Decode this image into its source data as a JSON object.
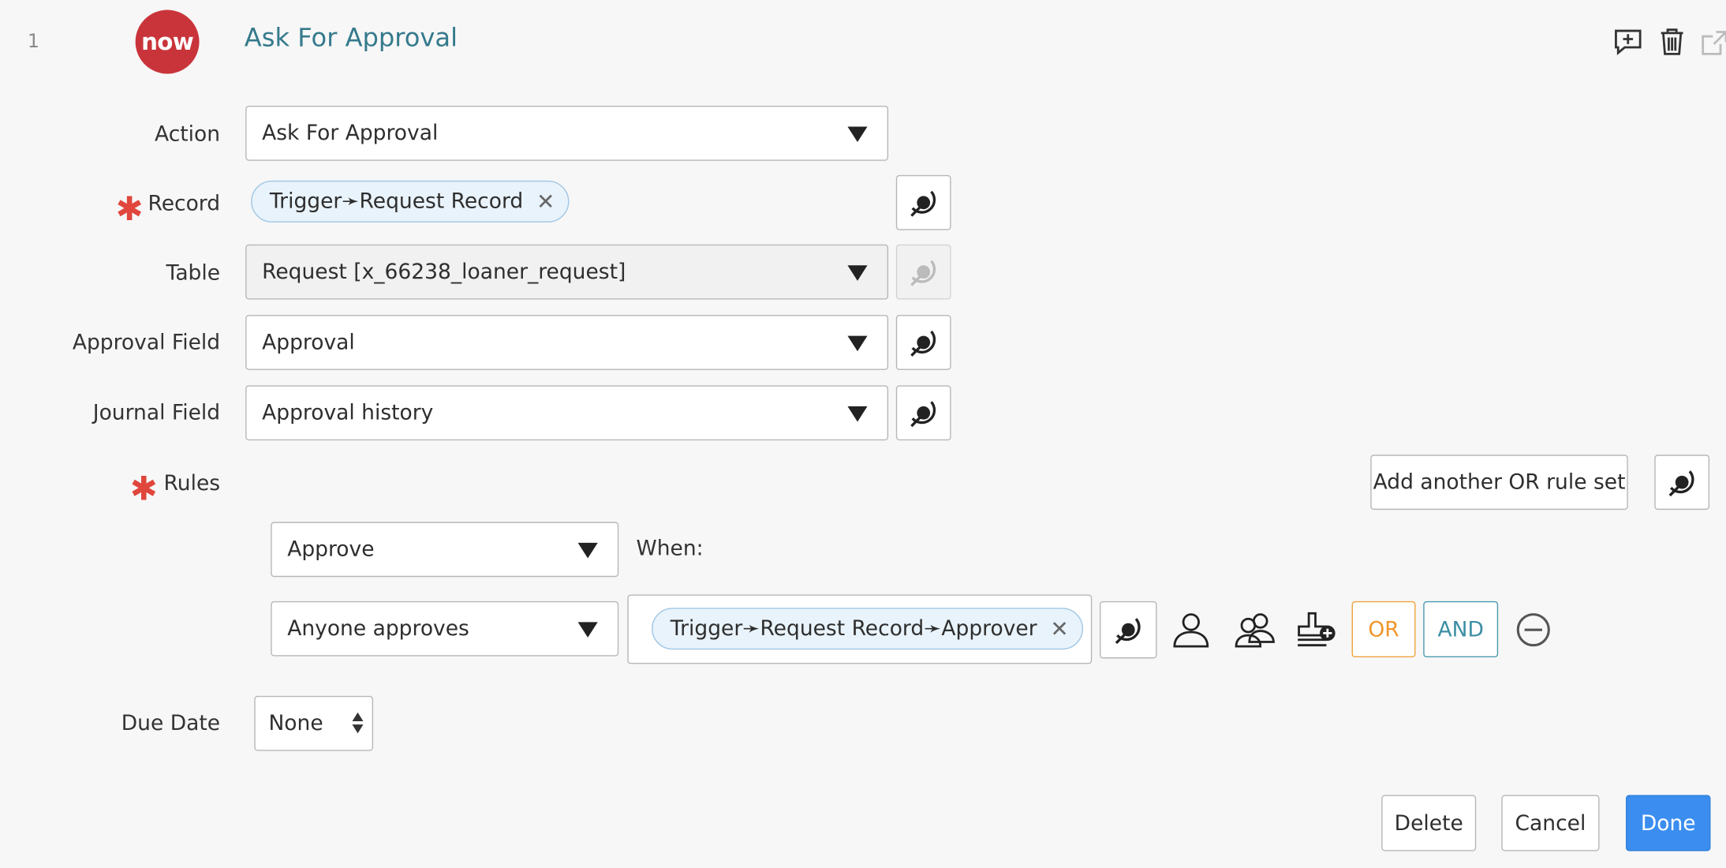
{
  "step": {
    "number": "1",
    "logo_text": "now",
    "title": "Ask For Approval"
  },
  "header_icons": [
    "add-comment-icon",
    "trash-icon",
    "popout-icon"
  ],
  "form": {
    "action": {
      "label": "Action",
      "value": "Ask For Approval"
    },
    "record": {
      "label": "Record",
      "required": true,
      "pill": "Trigger➛Request Record",
      "pill_remove": "✕"
    },
    "table": {
      "label": "Table",
      "value": "Request [x_66238_loaner_request]",
      "disabled": true
    },
    "approval_field": {
      "label": "Approval Field",
      "value": "Approval"
    },
    "journal_field": {
      "label": "Journal Field",
      "value": "Approval history"
    },
    "rules": {
      "label": "Rules",
      "required": true,
      "add_or_label": "Add another OR rule set",
      "rule": {
        "decision": "Approve",
        "when_label": "When:",
        "condition": "Anyone approves",
        "pill": "Trigger➛Request Record➛Approver",
        "pill_remove": "✕",
        "or_label": "OR",
        "and_label": "AND"
      }
    },
    "due_date": {
      "label": "Due Date",
      "value": "None"
    }
  },
  "footer": {
    "delete_label": "Delete",
    "cancel_label": "Cancel",
    "done_label": "Done"
  },
  "colors": {
    "brand_red": "#c9343a",
    "title_teal": "#357a8c",
    "required": "#e0463c",
    "primary": "#3b8ef0",
    "or": "#f0962c",
    "and": "#3c8ea4"
  }
}
